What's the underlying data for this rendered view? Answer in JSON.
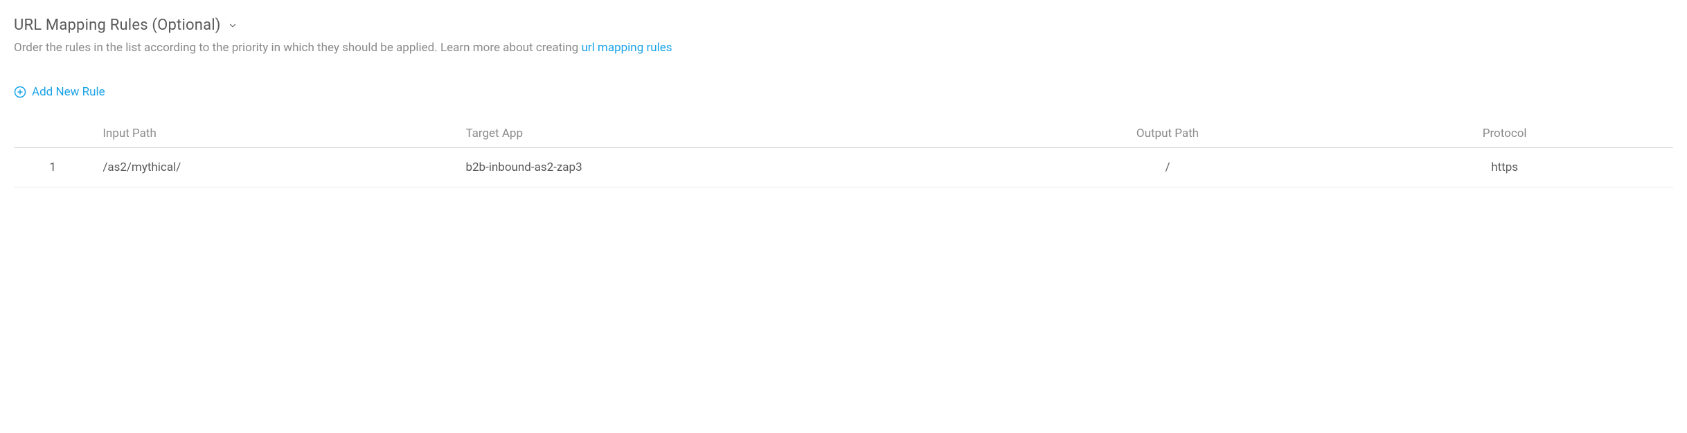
{
  "section": {
    "title": "URL Mapping Rules (Optional)",
    "description_prefix": "Order the rules in the list according to the priority in which they should be applied. Learn more about creating ",
    "description_link_text": "url mapping rules"
  },
  "actions": {
    "add_new_label": "Add New Rule"
  },
  "table": {
    "headers": {
      "index": "",
      "input_path": "Input Path",
      "target_app": "Target App",
      "output_path": "Output Path",
      "protocol": "Protocol"
    },
    "rows": [
      {
        "index": "1",
        "input_path": "/as2/mythical/",
        "target_app": "b2b-inbound-as2-zap3",
        "output_path": "/",
        "protocol": "https"
      }
    ]
  }
}
